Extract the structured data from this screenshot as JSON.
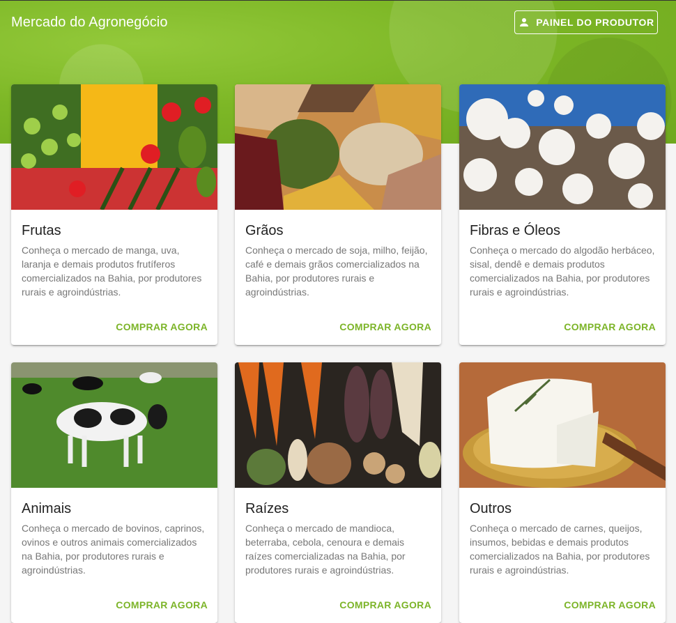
{
  "header": {
    "title": "Mercado do Agronegócio",
    "producer_button": "PAINEL DO PRODUTOR",
    "producer_icon": "person-icon",
    "brand_color": "#7db726"
  },
  "cards": [
    {
      "title": "Frutas",
      "description": "Conheça o mercado de manga, uva, laranja e demais produtos frutíferos comercializados na Bahia, por produtores rurais e agroindústrias.",
      "action": "COMPRAR AGORA",
      "image": "fruits-image"
    },
    {
      "title": "Grãos",
      "description": "Conheça o mercado de soja, milho, feijão, café e demais grãos comercializados na Bahia, por produtores rurais e agroindústrias.",
      "action": "COMPRAR AGORA",
      "image": "grains-image"
    },
    {
      "title": "Fibras e Óleos",
      "description": "Conheça o mercado do algodão herbáceo, sisal, dendê e demais produtos comercializados na Bahia, por produtores rurais e agroindústrias.",
      "action": "COMPRAR AGORA",
      "image": "cotton-image"
    },
    {
      "title": "Animais",
      "description": "Conheça o mercado de bovinos, caprinos, ovinos e outros animais comercializados na Bahia, por produtores rurais e agroindústrias.",
      "action": "COMPRAR AGORA",
      "image": "cows-image"
    },
    {
      "title": "Raízes",
      "description": "Conheça o mercado de mandioca, beterraba, cebola, cenoura e demais raízes comercializadas na Bahia, por produtores rurais e agroindústrias.",
      "action": "COMPRAR AGORA",
      "image": "roots-image"
    },
    {
      "title": "Outros",
      "description": "Conheça o mercado de carnes, queijos, insumos, bebidas e demais produtos comercializados na Bahia, por produtores rurais e agroindústrias.",
      "action": "COMPRAR AGORA",
      "image": "cheese-image"
    }
  ],
  "colors": {
    "accent": "#7cb428",
    "card_text": "#777777"
  }
}
